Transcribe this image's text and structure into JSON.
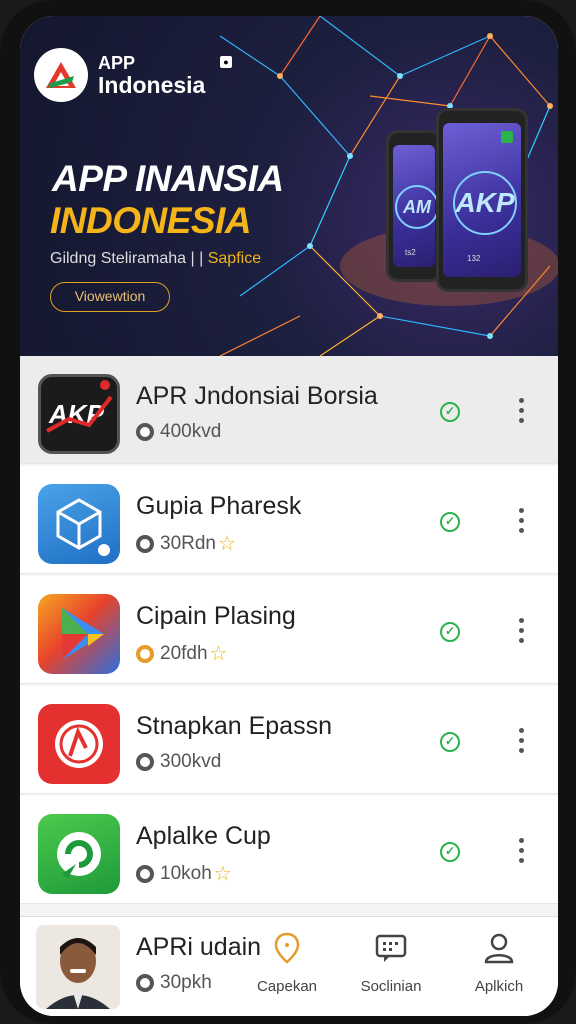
{
  "brand": {
    "line1": "APP",
    "line2": "Indonesia"
  },
  "hero": {
    "title1": "APP INANSIA",
    "title2": "INDONESIA",
    "subtitle_main": "Gildng Steliramaha | |",
    "subtitle_accent": "Sapfice",
    "button_label": "Viowewtion",
    "mock_phone_left_text": "AM",
    "mock_phone_right_text": "AKP",
    "mock_small_left": "ts2",
    "mock_small_right": "132"
  },
  "apps": [
    {
      "title": "APR Jndonsiai Borsia",
      "meta": "400kvd",
      "star": false,
      "meta_icon": "clock-icon",
      "meta_color": "gray",
      "icon": "akp-app-icon"
    },
    {
      "title": "Gupia Pharesk",
      "meta": "30Rdn",
      "star": true,
      "meta_icon": "clock-icon",
      "meta_color": "gray",
      "icon": "box-app-icon"
    },
    {
      "title": "Cipain Plasing",
      "meta": "20fdh",
      "star": true,
      "meta_icon": "clock-icon",
      "meta_color": "orange",
      "icon": "play-app-icon"
    },
    {
      "title": "Stnapkan Epassn",
      "meta": "300kvd",
      "star": false,
      "meta_icon": "clock-icon",
      "meta_color": "gray",
      "icon": "red-circle-app-icon"
    },
    {
      "title": "Aplalke Cup",
      "meta": "10koh",
      "star": true,
      "meta_icon": "clock-icon",
      "meta_color": "gray",
      "icon": "green-swirl-app-icon"
    }
  ],
  "bottom": {
    "title": "APRi udain",
    "meta": "30pkh",
    "nav": [
      {
        "label": "Capekan",
        "icon": "location-pin-icon"
      },
      {
        "label": "Soclinian",
        "icon": "chat-grid-icon"
      },
      {
        "label": "Aplkich",
        "icon": "user-icon"
      }
    ]
  },
  "colors": {
    "accent_gold": "#f4b41a",
    "check_green": "#2bb24c",
    "hero_bg": "#14172e"
  }
}
